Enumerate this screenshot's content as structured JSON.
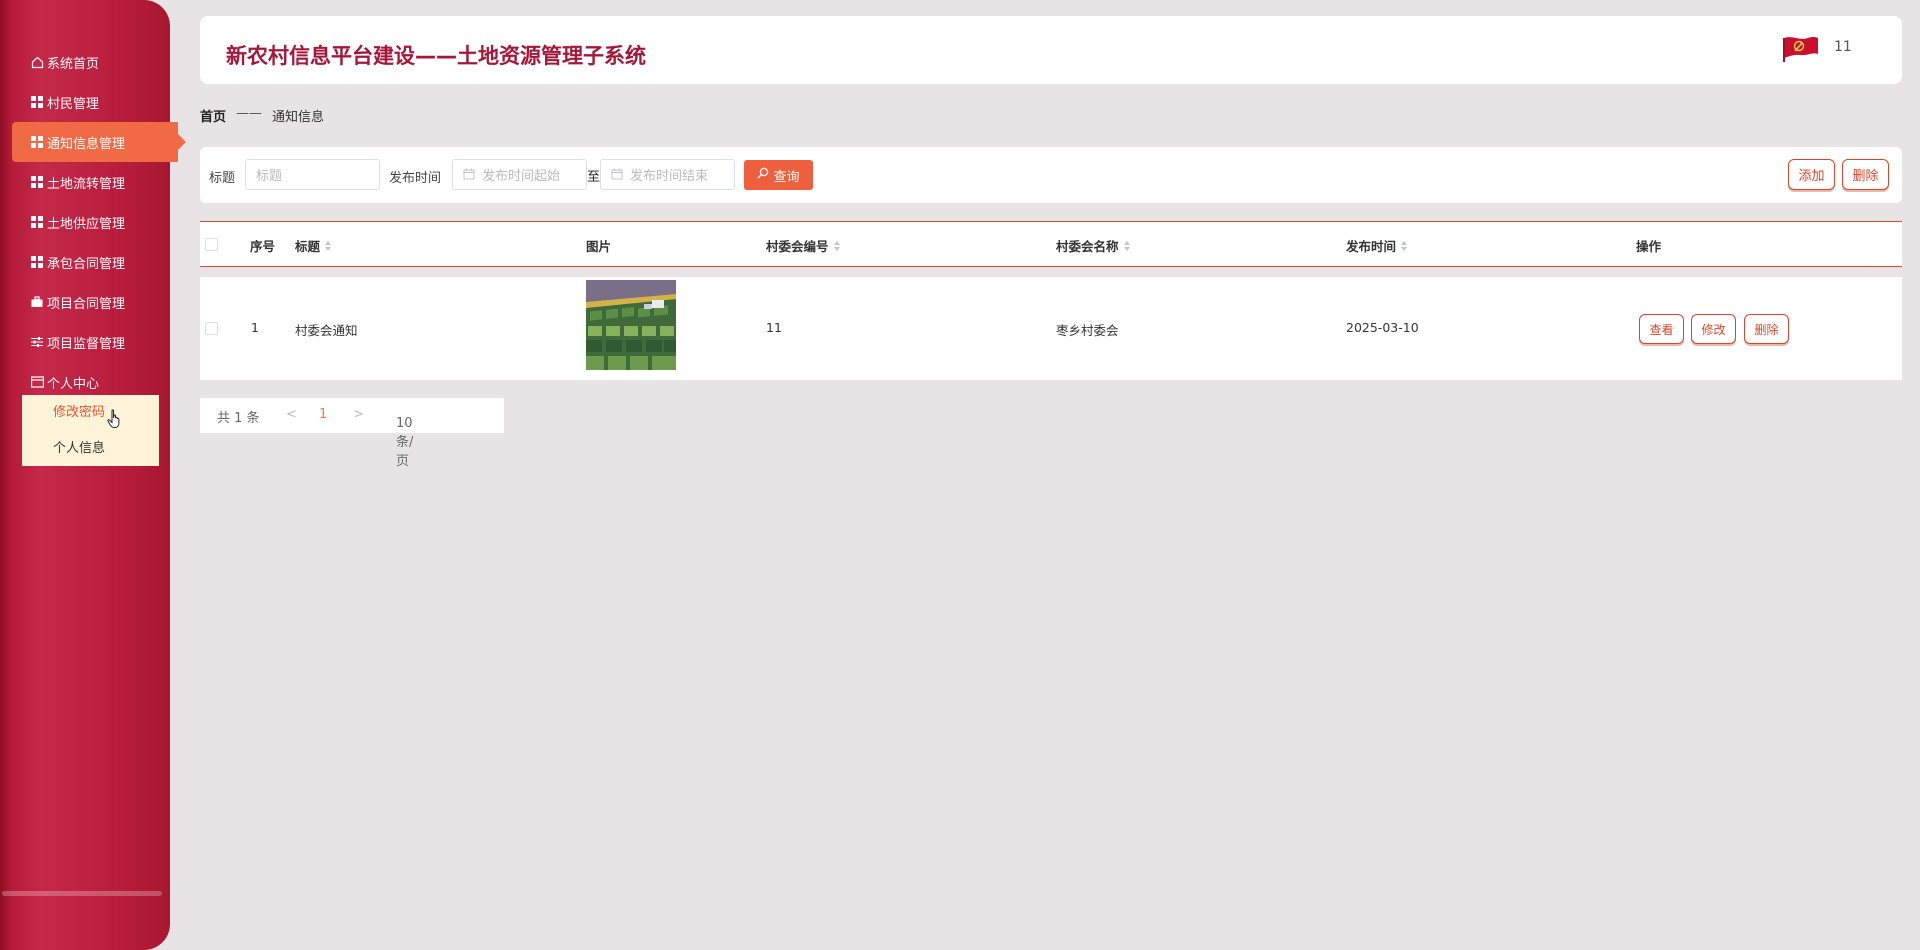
{
  "sidebar": {
    "items": [
      {
        "label": "系统首页",
        "icon": "home-icon"
      },
      {
        "label": "村民管理",
        "icon": "grid-icon"
      },
      {
        "label": "通知信息管理",
        "icon": "grid-icon",
        "active": true
      },
      {
        "label": "土地流转管理",
        "icon": "grid-icon"
      },
      {
        "label": "土地供应管理",
        "icon": "grid-icon"
      },
      {
        "label": "承包合同管理",
        "icon": "grid-icon"
      },
      {
        "label": "项目合同管理",
        "icon": "briefcase-icon"
      },
      {
        "label": "项目监督管理",
        "icon": "sliders-icon"
      },
      {
        "label": "个人中心",
        "icon": "card-icon"
      }
    ],
    "submenu": [
      {
        "label": "修改密码"
      },
      {
        "label": "个人信息"
      }
    ]
  },
  "header": {
    "title": "新农村信息平台建设——土地资源管理子系统",
    "user_name": "11"
  },
  "breadcrumb": {
    "home": "首页",
    "separator": "——",
    "current": "通知信息"
  },
  "filter": {
    "title_label": "标题",
    "title_placeholder": "标题",
    "time_label": "发布时间",
    "start_placeholder": "发布时间起始",
    "range_sep": "至",
    "end_placeholder": "发布时间结束",
    "query_label": "查询",
    "add_label": "添加",
    "delete_label": "删除"
  },
  "table": {
    "columns": [
      "序号",
      "标题",
      "图片",
      "村委会编号",
      "村委会名称",
      "发布时间",
      "操作"
    ],
    "rows": [
      {
        "index": "1",
        "title": "村委会通知",
        "committee_no": "11",
        "committee_name": "枣乡村委会",
        "publish_time": "2025-03-10",
        "actions": [
          "查看",
          "修改",
          "删除"
        ]
      }
    ]
  },
  "pager": {
    "total": "共 1 条",
    "prev": "<",
    "page": "1",
    "next": ">",
    "page_size": "10条/页"
  },
  "colors": {
    "accent": "#ee5f3d",
    "sidebar": "#b81d3d",
    "title": "#a3173a"
  }
}
